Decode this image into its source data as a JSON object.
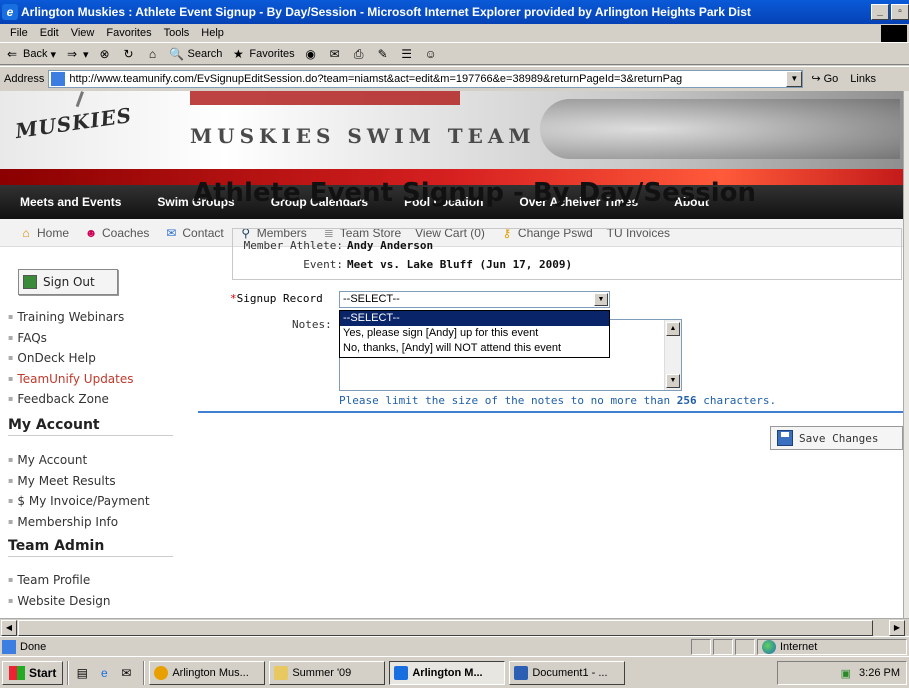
{
  "window": {
    "title": "Arlington Muskies : Athlete Event Signup - By Day/Session - Microsoft Internet Explorer provided by Arlington Heights Park Dist"
  },
  "menu": [
    "File",
    "Edit",
    "View",
    "Favorites",
    "Tools",
    "Help"
  ],
  "toolbar": {
    "back_label": "Back",
    "search_label": "Search",
    "favorites_label": "Favorites"
  },
  "address": {
    "label": "Address",
    "url": "http://www.teamunify.com/EvSignupEditSession.do?team=niamst&act=edit&m=197766&e=38989&returnPageId=3&returnPag",
    "go_label": "Go",
    "links_label": "Links"
  },
  "banner": {
    "logo_text": "MUSKIES",
    "team_title": "MUSKIES SWIM TEAM"
  },
  "nav": [
    "Meets and Events",
    "Swim Groups",
    "Group Calendars",
    "Pool Location",
    "Over Acheiver Times",
    "About"
  ],
  "subnav": [
    {
      "label": "Home",
      "icon": "home-icon"
    },
    {
      "label": "Coaches",
      "icon": "coaches-icon"
    },
    {
      "label": "Contact",
      "icon": "envelope-icon"
    },
    {
      "label": "Members",
      "icon": "magnifier-icon"
    },
    {
      "label": "Team Store",
      "icon": "store-icon"
    },
    {
      "label": "View Cart (0)",
      "icon": ""
    },
    {
      "label": "Change Pswd",
      "icon": "key-icon"
    },
    {
      "label": "TU Invoices",
      "icon": ""
    }
  ],
  "sidebar": {
    "sign_out": "Sign Out",
    "links1": [
      "Training Webinars",
      "FAQs",
      "OnDeck Help",
      "TeamUnify Updates",
      "Feedback Zone"
    ],
    "my_account_heading": "My Account",
    "links2": [
      "My Account",
      "My Meet Results",
      "$ My Invoice/Payment",
      "Membership Info"
    ],
    "team_admin_heading": "Team Admin",
    "links3": [
      "Team Profile",
      "Website Design"
    ]
  },
  "main": {
    "page_title": "Athlete Event Signup - By Day/Session",
    "member_label": "Member Athlete:",
    "member_value": "Andy Anderson",
    "event_label": "Event:",
    "event_value": "Meet vs. Lake Bluff (Jun 17, 2009)",
    "signup_required_mark": "*",
    "signup_label": "Signup Record",
    "signup_selected": "--SELECT--",
    "signup_options": [
      "--SELECT--",
      "Yes, please sign [Andy] up for this event",
      "No, thanks, [Andy] will NOT attend this event"
    ],
    "notes_label": "Notes:",
    "limit_note_prefix": "Please limit the size of the notes to no more than",
    "limit_note_number": "256",
    "limit_note_suffix": "characters.",
    "save_button": "Save Changes"
  },
  "status": {
    "text": "Done",
    "zone": "Internet"
  },
  "taskbar": {
    "start": "Start",
    "tasks": [
      "Arlington Mus...",
      "Summer '09",
      "Arlington M...",
      "Document1 - ..."
    ],
    "clock": "3:26 PM"
  }
}
